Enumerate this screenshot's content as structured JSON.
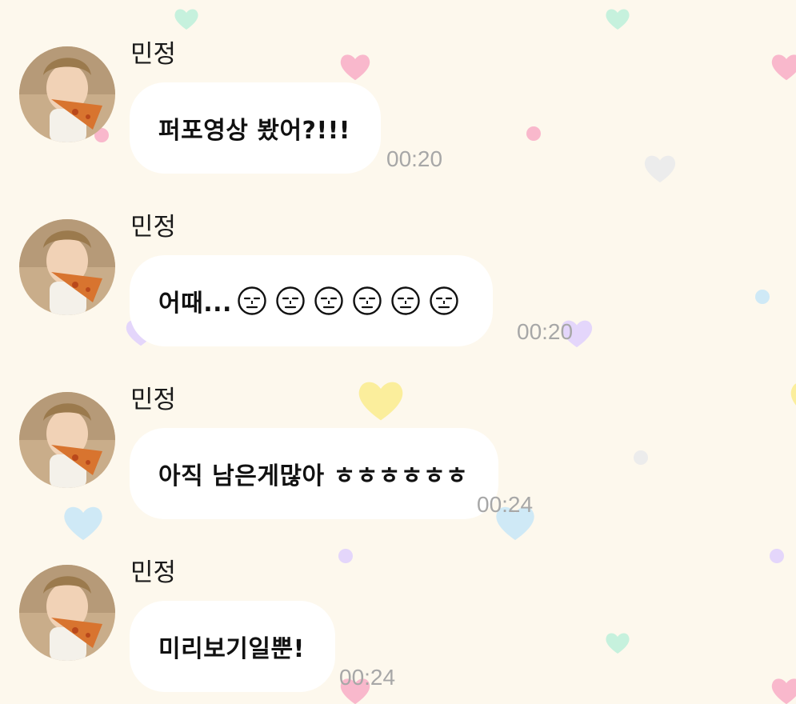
{
  "messages": [
    {
      "sender": "민정",
      "text": "퍼포영상 봤어?!!!",
      "time": "00:20",
      "emojis": []
    },
    {
      "sender": "민정",
      "text": "어때...",
      "time": "00:20",
      "emojis": [
        "sleepy-face-icon",
        "sleepy-face-icon",
        "sleepy-face-icon",
        "sleepy-face-icon",
        "sleepy-face-icon",
        "sleepy-face-icon"
      ]
    },
    {
      "sender": "민정",
      "text": "아직 남은게많아 ㅎㅎㅎㅎㅎㅎ",
      "time": "00:24",
      "emojis": []
    },
    {
      "sender": "민정",
      "text": "미리보기일뿐!",
      "time": "00:24",
      "emojis": []
    }
  ],
  "colors": {
    "background": "#fdf8ed",
    "bubble": "#ffffff",
    "time_text": "#a7a7a7",
    "heart_pink": "#f9b8cc",
    "heart_green": "#c6f1dd",
    "heart_yellow": "#fbee9c",
    "heart_blue": "#cfe9f6",
    "heart_purple": "#e4d6fb",
    "heart_gray": "#ececec"
  }
}
